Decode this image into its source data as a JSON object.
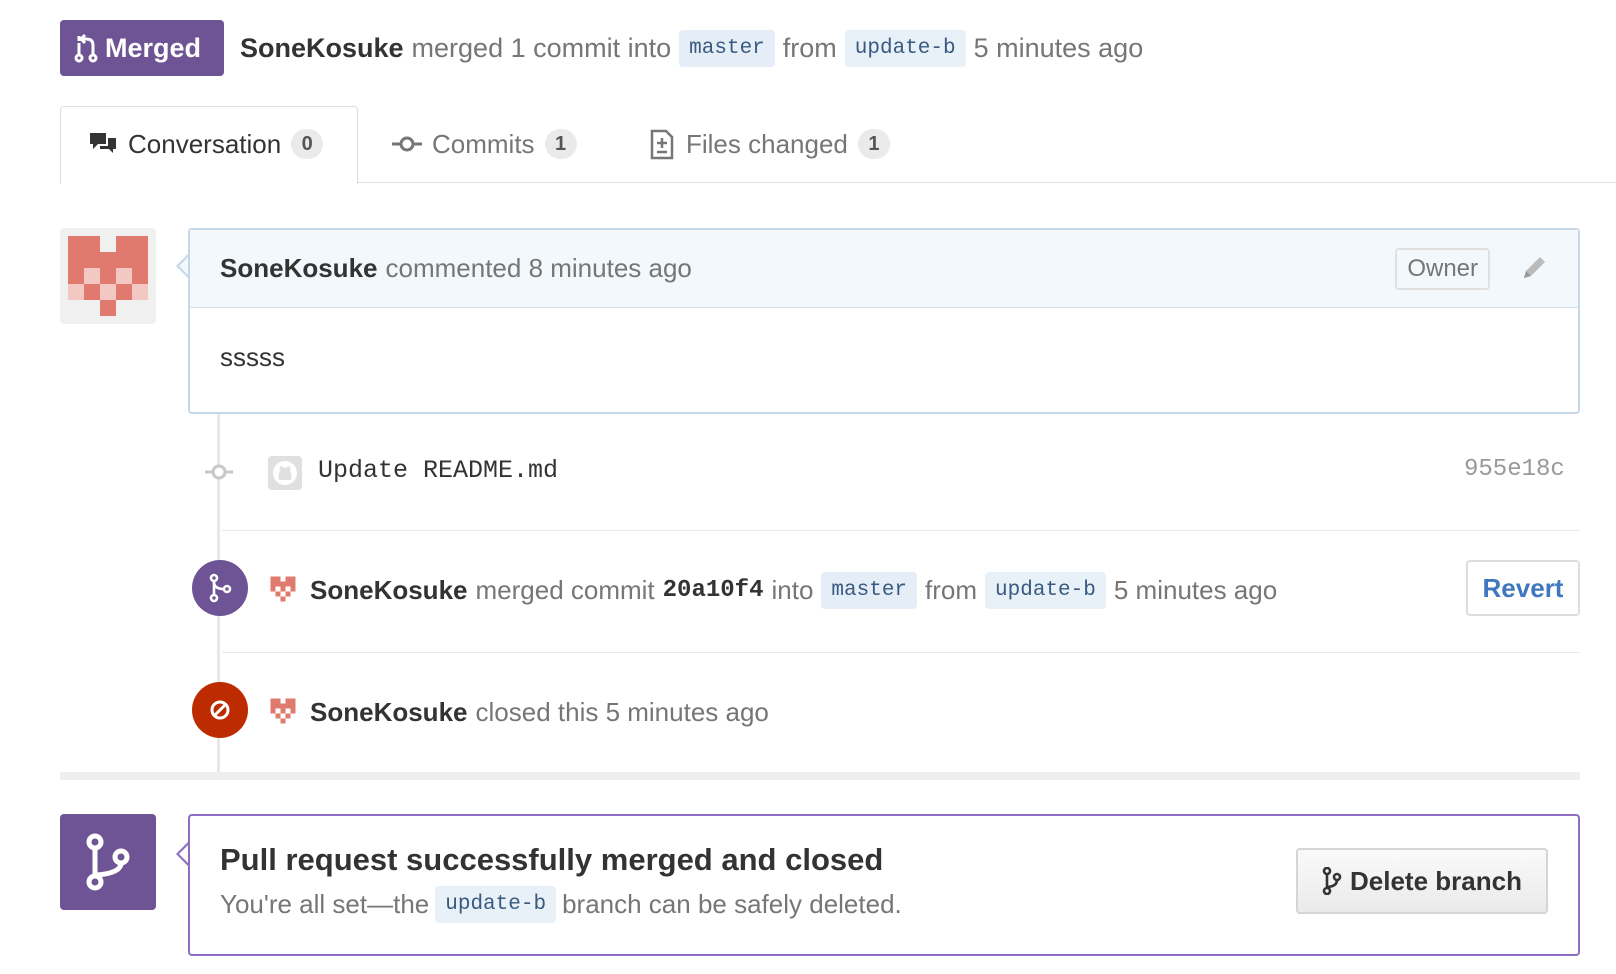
{
  "header": {
    "state": "Merged",
    "author": "SoneKosuke",
    "action": "merged 1 commit into",
    "base_branch": "master",
    "from_word": "from",
    "head_branch": "update-b",
    "time": "5 minutes ago"
  },
  "tabs": [
    {
      "label": "Conversation",
      "count": "0",
      "icon": "comment-discussion-icon"
    },
    {
      "label": "Commits",
      "count": "1",
      "icon": "git-commit-icon"
    },
    {
      "label": "Files changed",
      "count": "1",
      "icon": "diff-icon"
    }
  ],
  "comment": {
    "author": "SoneKosuke",
    "meta": "commented 8 minutes ago",
    "badge": "Owner",
    "body": "sssss"
  },
  "timeline": {
    "commit": {
      "message": "Update README.md",
      "sha": "955e18c"
    },
    "merged": {
      "author": "SoneKosuke",
      "text1": "merged commit",
      "sha": "20a10f4",
      "into_word": "into",
      "base_branch": "master",
      "from_word": "from",
      "head_branch": "update-b",
      "time": "5 minutes ago",
      "button": "Revert"
    },
    "closed": {
      "author": "SoneKosuke",
      "text": "closed this 5 minutes ago"
    }
  },
  "merge_box": {
    "title": "Pull request successfully merged and closed",
    "desc_before": "You're all set—the",
    "branch": "update-b",
    "desc_after": "branch can be safely deleted.",
    "button": "Delete branch"
  },
  "colors": {
    "merged_purple": "#6e5494",
    "closed_red": "#bd2c00",
    "link_blue": "#4078c0",
    "avatar_red": "#e07a6e"
  }
}
